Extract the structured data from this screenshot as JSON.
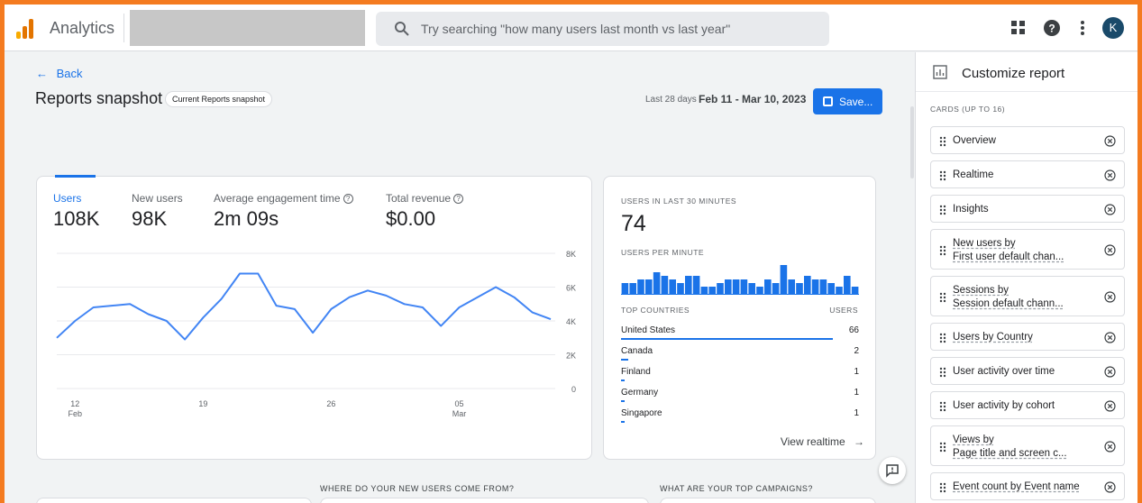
{
  "topbar": {
    "app_name": "Analytics",
    "search_placeholder": "Try searching \"how many users last month vs last year\"",
    "avatar_letter": "K",
    "logo_colors": [
      "#f9ab00",
      "#e37400",
      "#e37400"
    ]
  },
  "header": {
    "back_label": "Back",
    "title": "Reports snapshot",
    "chip": "Current Reports snapshot",
    "date_range_label": "Last 28 days",
    "date_range_value": "Feb 11 - Mar 10, 2023",
    "save_label": "Save..."
  },
  "metrics": [
    {
      "label": "Users",
      "value": "108K"
    },
    {
      "label": "New users",
      "value": "98K"
    },
    {
      "label": "Average engagement time",
      "value": "2m 09s"
    },
    {
      "label": "Total revenue",
      "value": "$0.00"
    }
  ],
  "chart_data": {
    "type": "line",
    "x_tick_labels": [
      {
        "day": "12",
        "month": "Feb"
      },
      {
        "day": "19",
        "month": ""
      },
      {
        "day": "26",
        "month": ""
      },
      {
        "day": "05",
        "month": "Mar"
      }
    ],
    "y_ticks": [
      "8K",
      "6K",
      "4K",
      "2K",
      "0"
    ],
    "ylim": [
      0,
      8000
    ],
    "series": [
      {
        "values": [
          3000,
          4000,
          4800,
          4900,
          5000,
          4400,
          4000,
          2900,
          4200,
          5300,
          6800,
          6800,
          4900,
          4700,
          3300,
          4700,
          5400,
          5800,
          5500,
          5000,
          4800,
          3700,
          4800,
          5400,
          6000,
          5400,
          4500,
          4100
        ],
        "color": "#4285f4"
      }
    ]
  },
  "realtime": {
    "users_label": "USERS IN LAST 30 MINUTES",
    "users_value": "74",
    "per_minute_label": "USERS PER MINUTE",
    "per_minute_bars": [
      2,
      2,
      3,
      3,
      5,
      4,
      3,
      2,
      4,
      4,
      1,
      1,
      2,
      3,
      3,
      3,
      2,
      1,
      3,
      2,
      7,
      3,
      2,
      4,
      3,
      3,
      2,
      1,
      4,
      1
    ],
    "countries_header": "TOP COUNTRIES",
    "users_header": "USERS",
    "countries": [
      {
        "name": "United States",
        "users": "66",
        "share": 0.89
      },
      {
        "name": "Canada",
        "users": "2",
        "share": 0.03
      },
      {
        "name": "Finland",
        "users": "1",
        "share": 0.015
      },
      {
        "name": "Germany",
        "users": "1",
        "share": 0.015
      },
      {
        "name": "Singapore",
        "users": "1",
        "share": 0.015
      }
    ],
    "view_label": "View realtime"
  },
  "sections": {
    "new_users": "WHERE DO YOUR NEW USERS COME FROM?",
    "campaigns": "WHAT ARE YOUR TOP CAMPAIGNS?"
  },
  "sidebar": {
    "title": "Customize report",
    "cards_label": "CARDS (UP TO 16)",
    "items": [
      {
        "lines": [
          "Overview"
        ],
        "dashed": false
      },
      {
        "lines": [
          "Realtime"
        ],
        "dashed": false
      },
      {
        "lines": [
          "Insights"
        ],
        "dashed": false
      },
      {
        "lines": [
          "New users by",
          "First user default chan..."
        ],
        "dashed": true
      },
      {
        "lines": [
          "Sessions by",
          "Session default chann..."
        ],
        "dashed": true
      },
      {
        "lines": [
          "Users by Country"
        ],
        "dashed": true
      },
      {
        "lines": [
          "User activity over time"
        ],
        "dashed": false
      },
      {
        "lines": [
          "User activity by cohort"
        ],
        "dashed": false
      },
      {
        "lines": [
          "Views by",
          "Page title and screen c..."
        ],
        "dashed": true
      },
      {
        "lines": [
          "Event count by Event name"
        ],
        "dashed": true
      }
    ]
  },
  "accent_color": "#1a73e8",
  "frame_color": "#f47b20"
}
